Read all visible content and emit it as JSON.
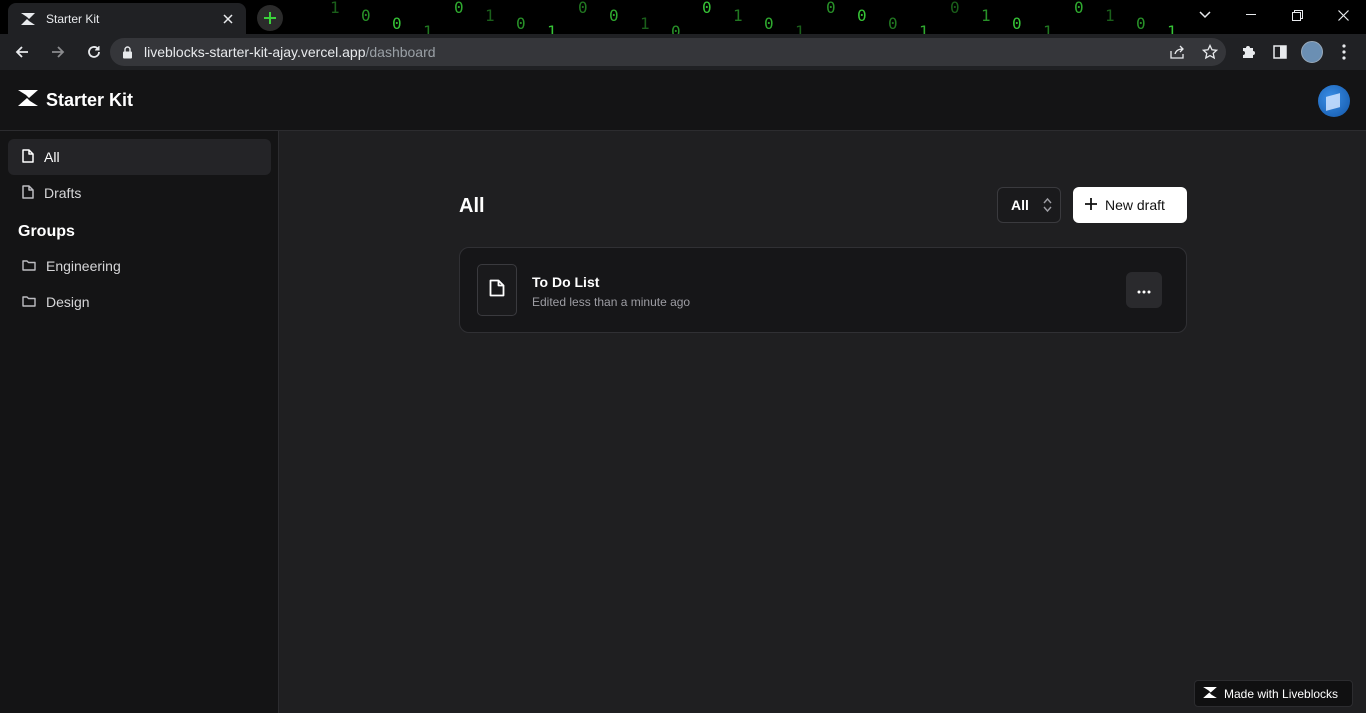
{
  "browser": {
    "tab_title": "Starter Kit",
    "url_host": "liveblocks-starter-kit-ajay.vercel.app",
    "url_path": "/dashboard",
    "matrix_glyphs": [
      "1",
      "0",
      "0",
      "1",
      "0",
      "1",
      "0",
      "1",
      "0",
      "0",
      "1",
      "0",
      "0",
      "1",
      "0",
      "1",
      "0",
      "0",
      "0",
      "1",
      "0",
      "1",
      "0",
      "1",
      "0",
      "1",
      "0",
      "1"
    ]
  },
  "app": {
    "brand": "Starter Kit",
    "sidebar": {
      "items": [
        {
          "label": "All",
          "icon": "file-icon"
        },
        {
          "label": "Drafts",
          "icon": "file-icon"
        }
      ],
      "groups_heading": "Groups",
      "groups": [
        {
          "label": "Engineering",
          "icon": "folder-icon"
        },
        {
          "label": "Design",
          "icon": "folder-icon"
        }
      ]
    },
    "main": {
      "title": "All",
      "filter_value": "All",
      "new_draft_label": "New draft",
      "documents": [
        {
          "name": "To Do List",
          "meta": "Edited less than a minute ago"
        }
      ]
    },
    "footer_badge": "Made with Liveblocks"
  },
  "colors": {
    "accent_green": "#3bd23b",
    "background": "#1f1f21",
    "panel": "#141415"
  }
}
